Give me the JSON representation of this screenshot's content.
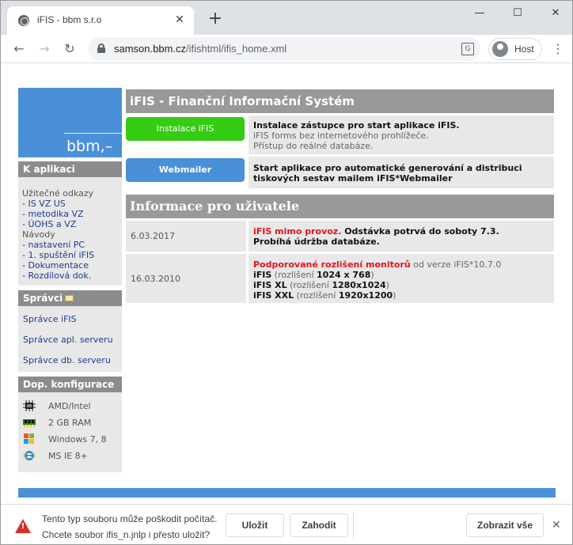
{
  "tab": {
    "title": "iFIS - bbm s.r.o",
    "close": "✕"
  },
  "newtab": "+",
  "window": {
    "minimize": "—",
    "maximize": "☐",
    "close": "✕"
  },
  "nav": {
    "back": "←",
    "forward": "→",
    "reload": "↻"
  },
  "omnibox": {
    "host": "samson.bbm.cz",
    "path": "/ifishtml/ifis_home.xml"
  },
  "profile": {
    "name": "Host"
  },
  "menu": "⋮",
  "sidebar": {
    "logo_text": "bbm,–",
    "apps_title": "K aplikaci",
    "apps_intro": "Užitečné odkazy",
    "links": [
      "- IS VZ US",
      "- metodika VZ",
      "- ÚOHS a VZ"
    ],
    "guides_label": "Návody",
    "guides": [
      "- nastavení PC",
      "- 1. spuštění iFIS",
      "- Dokumentace",
      "- Rozdílová dok."
    ],
    "admins_title": "Správci",
    "admins": [
      "Správce iFIS",
      "Správce apl. serveru",
      "Správce db. serveru"
    ],
    "config_title": "Dop. konfigurace",
    "config": [
      "AMD/Intel",
      "2 GB RAM",
      "Windows 7, 8",
      "MS IE 8+"
    ]
  },
  "main": {
    "title": "iFIS - Finanční Informační Systém",
    "install": {
      "button": "Instalace iFIS",
      "line1": "Instalace zástupce pro start aplikace iFIS.",
      "line2": "iFIS forms bez internetového prohlížeče.",
      "line3": "Přístup do reálné databáze."
    },
    "webmailer": {
      "button": "Webmailer",
      "line1": "Start aplikace pro automatické generování a distribuci",
      "line2": "tiskových sestav mailem iFIS*Webmailer"
    },
    "info_title": "Informace pro uživatele",
    "news": [
      {
        "date": "6.03.2017",
        "red": "iFIS mimo provoz.",
        "text": " Odstávka potrvá do soboty 7.3.",
        "line2": "Probíhá údržba databáze."
      },
      {
        "date": "16.03.2010",
        "red": "Podporované rozlišení monitorů",
        "gray": " od verze iFIS*10.7.0",
        "r1_name": "iFIS",
        "r1_pre": " (rozlišení ",
        "r1_val": "1024 x 768",
        "r1_post": ")",
        "r2_name": "iFIS XL",
        "r2_pre": " (rozlišení ",
        "r2_val": "1280x1024",
        "r2_post": ")",
        "r3_name": "iFIS XXL",
        "r3_pre": " (rozlišení ",
        "r3_val": "1920x1200",
        "r3_post": ")"
      }
    ]
  },
  "download": {
    "line1": "Tento typ souboru může poškodit počítač.",
    "line2": "Chcete soubor ifis_n.jnlp i přesto uložit?",
    "save": "Uložit",
    "discard": "Zahodit",
    "show_all": "Zobrazit vše",
    "close": "✕",
    "warning_mark": "!"
  },
  "colors": {
    "accent_blue": "#4a90d9",
    "install_green": "#35cc12",
    "warning_red": "#d93025",
    "header_gray": "#999999"
  }
}
